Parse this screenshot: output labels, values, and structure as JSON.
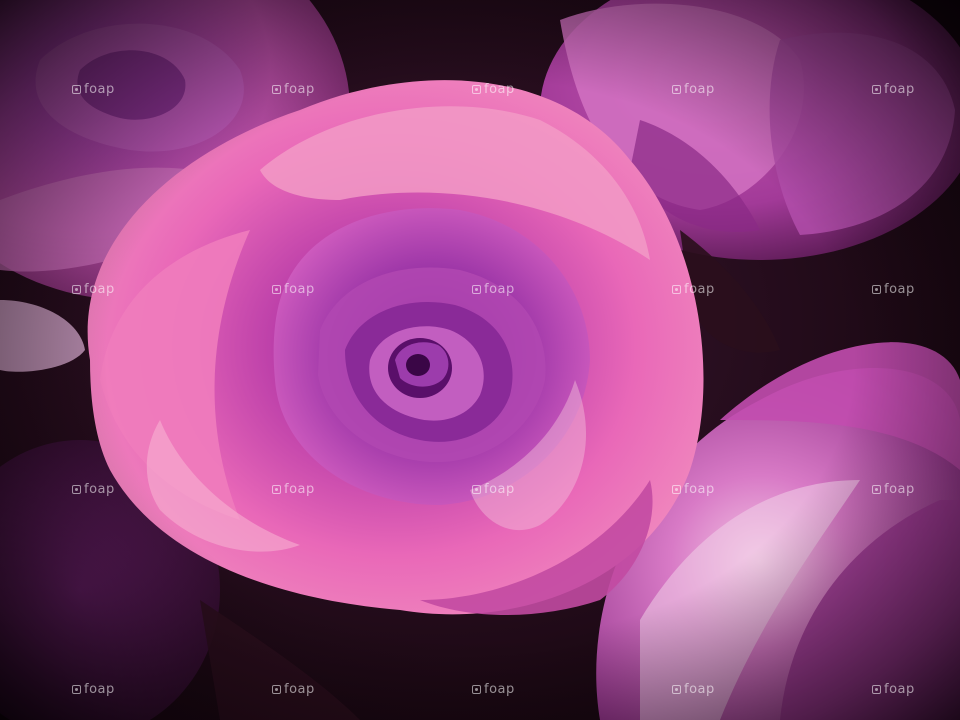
{
  "image": {
    "subject": "pink-purple roses close-up",
    "colors": {
      "petal_light": "#f27ac0",
      "petal_mid": "#d24aa8",
      "petal_deep": "#8e1f86",
      "petal_highlight": "#f7c6de",
      "background_dark": "#1a0812"
    }
  },
  "watermark": {
    "text": "foap",
    "icon": "camera-square-icon"
  }
}
